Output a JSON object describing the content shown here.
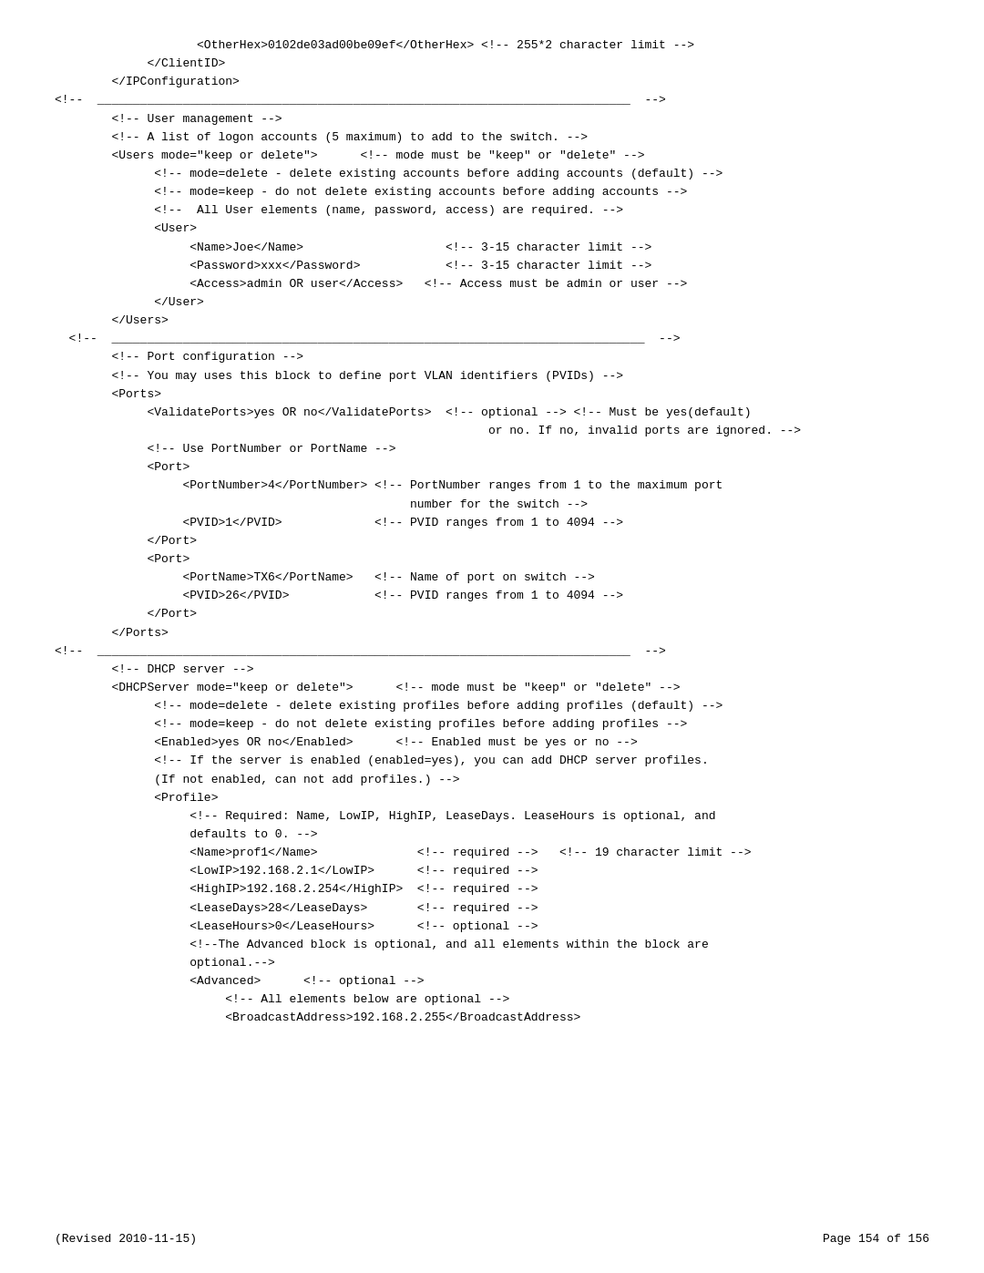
{
  "footer": {
    "left": "(Revised 2010-11-15)",
    "right": "Page 154 of 156"
  },
  "content": {
    "lines": [
      "                    <OtherHex>0102de03ad00be09ef</OtherHex> <!-- 255*2 character limit -->",
      "             </ClientID>",
      "        </IPConfiguration>",
      "",
      "",
      "<!--  ___________________________________________________________________________  -->",
      "",
      "        <!-- User management -->",
      "        <!-- A list of logon accounts (5 maximum) to add to the switch. -->",
      "",
      "        <Users mode=\"keep or delete\">      <!-- mode must be \"keep\" or \"delete\" -->",
      "              <!-- mode=delete - delete existing accounts before adding accounts (default) -->",
      "              <!-- mode=keep - do not delete existing accounts before adding accounts -->",
      "",
      "              <!--  All User elements (name, password, access) are required. -->",
      "              <User>",
      "                   <Name>Joe</Name>                    <!-- 3-15 character limit -->",
      "                   <Password>xxx</Password>            <!-- 3-15 character limit -->",
      "                   <Access>admin OR user</Access>   <!-- Access must be admin or user -->",
      "              </User>",
      "        </Users>",
      "",
      "  <!--  ___________________________________________________________________________  -->",
      "",
      "        <!-- Port configuration -->",
      "        <!-- You may uses this block to define port VLAN identifiers (PVIDs) -->",
      "        <Ports>",
      "             <ValidatePorts>yes OR no</ValidatePorts>  <!-- optional --> <!-- Must be yes(default)",
      "                                                             or no. If no, invalid ports are ignored. -->",
      "",
      "             <!-- Use PortNumber or PortName -->",
      "             <Port>",
      "                  <PortNumber>4</PortNumber> <!-- PortNumber ranges from 1 to the maximum port",
      "                                                  number for the switch -->",
      "                  <PVID>1</PVID>             <!-- PVID ranges from 1 to 4094 -->",
      "             </Port>",
      "             <Port>",
      "                  <PortName>TX6</PortName>   <!-- Name of port on switch -->",
      "                  <PVID>26</PVID>            <!-- PVID ranges from 1 to 4094 -->",
      "             </Port>",
      "        </Ports>",
      "",
      "<!--  ___________________________________________________________________________  -->",
      "",
      "        <!-- DHCP server -->",
      "",
      "        <DHCPServer mode=\"keep or delete\">      <!-- mode must be \"keep\" or \"delete\" -->",
      "              <!-- mode=delete - delete existing profiles before adding profiles (default) -->",
      "              <!-- mode=keep - do not delete existing profiles before adding profiles -->",
      "",
      "              <Enabled>yes OR no</Enabled>      <!-- Enabled must be yes or no -->",
      "",
      "              <!-- If the server is enabled (enabled=yes), you can add DHCP server profiles.",
      "              (If not enabled, can not add profiles.) -->",
      "              <Profile>",
      "",
      "                   <!-- Required: Name, LowIP, HighIP, LeaseDays. LeaseHours is optional, and",
      "                   defaults to 0. -->",
      "                   <Name>prof1</Name>              <!-- required -->   <!-- 19 character limit -->",
      "                   <LowIP>192.168.2.1</LowIP>      <!-- required -->",
      "                   <HighIP>192.168.2.254</HighIP>  <!-- required -->",
      "                   <LeaseDays>28</LeaseDays>       <!-- required -->",
      "                   <LeaseHours>0</LeaseHours>      <!-- optional -->",
      "",
      "                   <!--The Advanced block is optional, and all elements within the block are",
      "                   optional.-->",
      "                   <Advanced>      <!-- optional -->",
      "                        <!-- All elements below are optional -->",
      "                        <BroadcastAddress>192.168.2.255</BroadcastAddress>"
    ]
  }
}
